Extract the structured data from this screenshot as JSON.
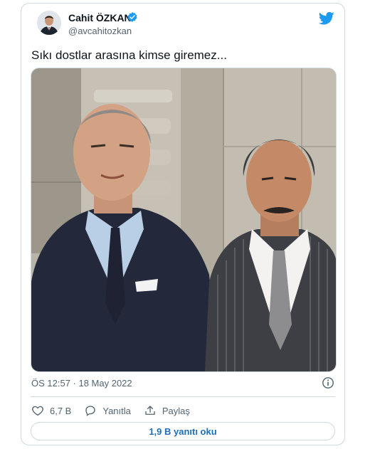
{
  "author": {
    "name": "Cahit ÖZKAN",
    "handle": "@avcahitozkan"
  },
  "tweet": {
    "text": "Sıkı dostlar arasına kimse giremez...",
    "timestamp": "ÖS 12:57 · 18 May 2022"
  },
  "actions": {
    "likes": "6,7 B",
    "reply_label": "Yanıtla",
    "share_label": "Paylaş"
  },
  "replies_button": "1,9 B yanıtı oku",
  "colors": {
    "brand_blue": "#1d9bf0",
    "link_blue": "#1d6fb8",
    "secondary_text": "#536471",
    "border": "#cfd9de"
  },
  "icons": [
    "verified-badge-icon",
    "twitter-bird-icon",
    "info-icon",
    "heart-icon",
    "reply-icon",
    "share-icon"
  ]
}
